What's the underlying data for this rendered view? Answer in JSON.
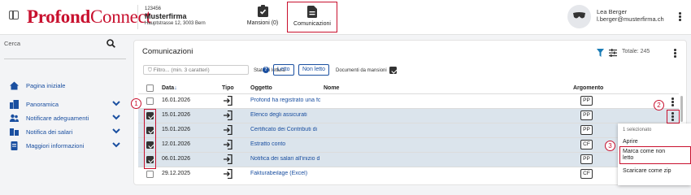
{
  "app": {
    "brand_bold": "Profond",
    "brand_light": "Connect"
  },
  "company": {
    "id": "123456",
    "name": "Musterfirma",
    "address": "Hauptstrasse 12, 3003 Bern"
  },
  "nav": {
    "mansioni": "Mansioni (0)",
    "comunicazioni": "Comunicazioni"
  },
  "user": {
    "name": "Lea Berger",
    "email": "l.berger@musterfirma.ch"
  },
  "sidebar": {
    "search_placeholder": "Cerca",
    "items": [
      {
        "label": "Pagina iniziale",
        "icon": "home-icon"
      },
      {
        "label": "Panoramica",
        "icon": "building-icon"
      },
      {
        "label": "Notificare adeguamenti",
        "icon": "users-icon"
      },
      {
        "label": "Notifica dei salari",
        "icon": "salary-icon"
      },
      {
        "label": "Maggiori informazioni",
        "icon": "document-icon"
      }
    ]
  },
  "panel": {
    "title": "Comunicazioni",
    "total": "Totale: 245",
    "filter_placeholder": "Filtro... (min. 3 caratteri)",
    "read_state_label": "Stato di lettura",
    "letto": "Letto",
    "non_letto": "Non letto",
    "docs_label": "Documenti da mansioni"
  },
  "table": {
    "headers": {
      "data": "Data",
      "tipo": "Tipo",
      "oggetto": "Oggetto",
      "nome": "Nome",
      "argomento": "Argomento"
    },
    "rows": [
      {
        "date": "16.01.2026",
        "subject": "Profond ha registrato una fc",
        "topic": "PP",
        "checked": false
      },
      {
        "date": "15.01.2026",
        "subject": "Elenco degli assicurati",
        "topic": "PP",
        "checked": true
      },
      {
        "date": "15.01.2026",
        "subject": "Certificato dei Contributi di",
        "topic": "PP",
        "checked": true
      },
      {
        "date": "12.01.2026",
        "subject": "Estratto conto",
        "topic": "CF",
        "checked": true
      },
      {
        "date": "06.01.2026",
        "subject": "Notifica dei salari all'inizio d",
        "topic": "PP",
        "checked": true
      },
      {
        "date": "29.12.2025",
        "subject": "Fakturabeilage (Excel)",
        "topic": "CF",
        "checked": false
      }
    ]
  },
  "context_menu": {
    "header": "1 selezionato",
    "open": "Aprire",
    "mark_unread_1": "Marca come non",
    "mark_unread_2": "letto",
    "download_zip": "Scaricare come zip"
  },
  "annotations": [
    "1",
    "2",
    "3"
  ],
  "colors": {
    "brand_red": "#c8102e",
    "link_blue": "#1a4fa0",
    "selected_row": "#dbe4ec"
  }
}
